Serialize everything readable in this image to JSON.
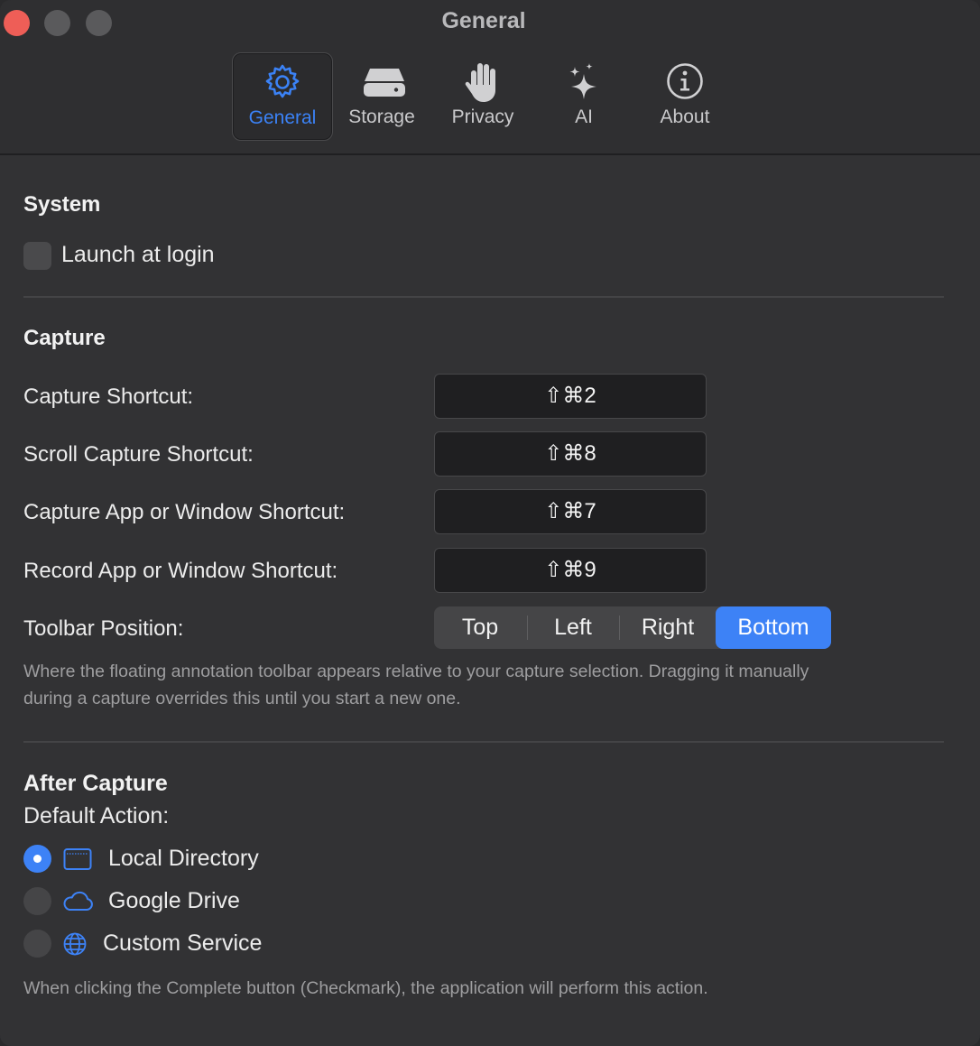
{
  "window": {
    "title": "General"
  },
  "tabs": [
    {
      "label": "General",
      "icon": "gear-icon",
      "active": true
    },
    {
      "label": "Storage",
      "icon": "drive-icon",
      "active": false
    },
    {
      "label": "Privacy",
      "icon": "hand-icon",
      "active": false
    },
    {
      "label": "AI",
      "icon": "sparkles-icon",
      "active": false
    },
    {
      "label": "About",
      "icon": "info-icon",
      "active": false
    }
  ],
  "system": {
    "title": "System",
    "launch_at_login": {
      "label": "Launch at login",
      "checked": false
    }
  },
  "capture": {
    "title": "Capture",
    "shortcuts": [
      {
        "label": "Capture Shortcut:",
        "value": "⇧⌘2"
      },
      {
        "label": "Scroll Capture Shortcut:",
        "value": "⇧⌘8"
      },
      {
        "label": "Capture App or Window Shortcut:",
        "value": "⇧⌘7"
      },
      {
        "label": "Record App or Window Shortcut:",
        "value": "⇧⌘9"
      }
    ],
    "toolbar_position": {
      "label": "Toolbar Position:",
      "options": [
        "Top",
        "Left",
        "Right",
        "Bottom"
      ],
      "selected": "Bottom"
    },
    "help_line1": "Where the floating annotation toolbar appears relative to your capture selection. Dragging it manually",
    "help_line2": "during a capture overrides this until you start a new one."
  },
  "after_capture": {
    "title": "After Capture",
    "default_action_label": "Default Action:",
    "options": [
      {
        "label": "Local Directory",
        "icon": "folder-window-icon",
        "selected": true
      },
      {
        "label": "Google Drive",
        "icon": "cloud-icon",
        "selected": false
      },
      {
        "label": "Custom Service",
        "icon": "globe-icon",
        "selected": false
      }
    ],
    "help": "When clicking the Complete button (Checkmark), the application will perform this action."
  },
  "colors": {
    "accent": "#3d82f6",
    "background": "#323234",
    "close": "#ee5e57"
  }
}
